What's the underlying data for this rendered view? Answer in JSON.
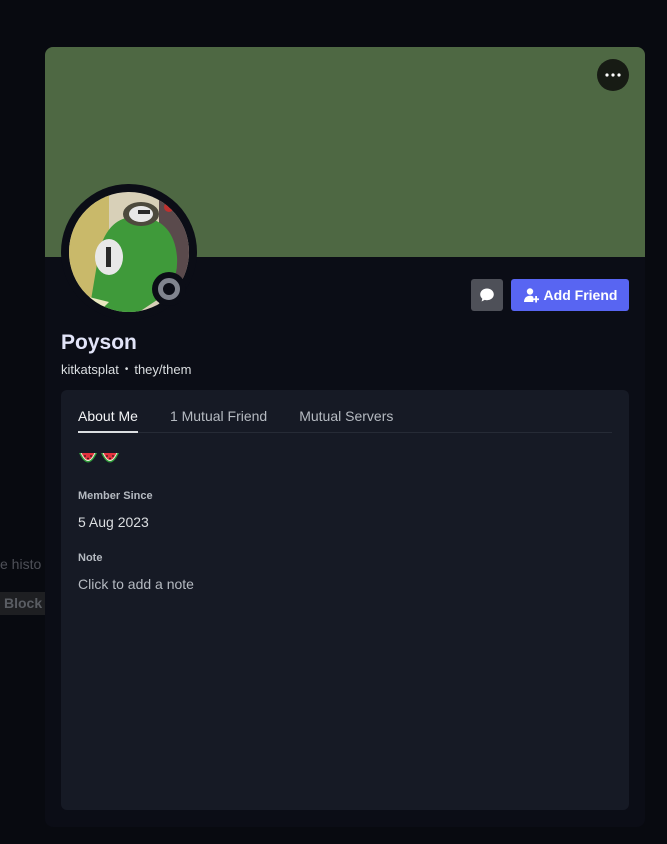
{
  "backdrop": {
    "history_fragment": "e histo",
    "block_label": "Block"
  },
  "profile": {
    "display_name": "Poyson",
    "username": "kitkatsplat",
    "separator": "•",
    "pronouns": "they/them",
    "banner_color": "#4e6843",
    "status": "offline",
    "bio": "🍉🍉"
  },
  "actions": {
    "more_icon": "ellipsis-icon",
    "message_icon": "chat-bubble-icon",
    "add_friend_label": "Add Friend",
    "add_friend_icon": "person-add-icon",
    "accent": "#5865f2"
  },
  "tabs": [
    {
      "label": "About Me",
      "active": true
    },
    {
      "label": "1 Mutual Friend",
      "active": false
    },
    {
      "label": "Mutual Servers",
      "active": false
    }
  ],
  "about": {
    "member_since_label": "Member Since",
    "member_since_value": "5 Aug 2023",
    "note_label": "Note",
    "note_placeholder": "Click to add a note"
  }
}
